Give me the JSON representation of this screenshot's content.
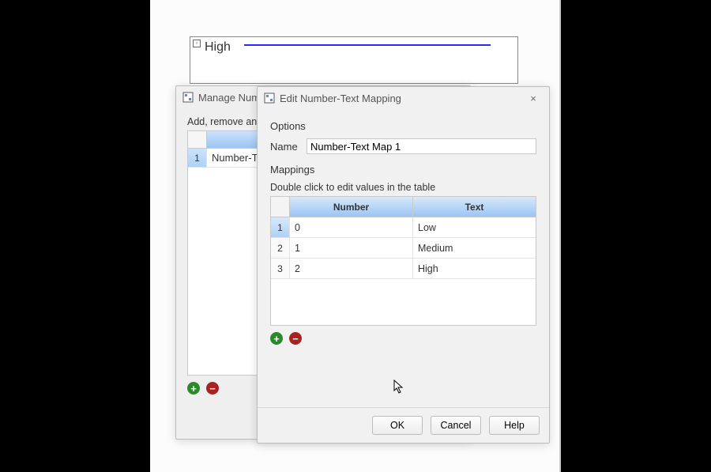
{
  "canvas": {
    "value_label": "High"
  },
  "manage_dialog": {
    "title": "Manage Number",
    "instruction": "Add, remove and edit",
    "rows": [
      {
        "index": "1",
        "name": "Number-Text M"
      }
    ]
  },
  "edit_dialog": {
    "title": "Edit Number-Text Mapping",
    "options_label": "Options",
    "name_label": "Name",
    "name_value": "Number-Text Map 1",
    "mappings_label": "Mappings",
    "hint": "Double click to edit values in the table",
    "columns": {
      "number": "Number",
      "text": "Text"
    },
    "rows": [
      {
        "index": "1",
        "number": "0",
        "text": "Low"
      },
      {
        "index": "2",
        "number": "1",
        "text": "Medium"
      },
      {
        "index": "3",
        "number": "2",
        "text": "High"
      }
    ],
    "buttons": {
      "ok": "OK",
      "cancel": "Cancel",
      "help": "Help"
    }
  },
  "icons": {
    "add_tooltip": "+",
    "remove_tooltip": "−",
    "close": "×"
  }
}
